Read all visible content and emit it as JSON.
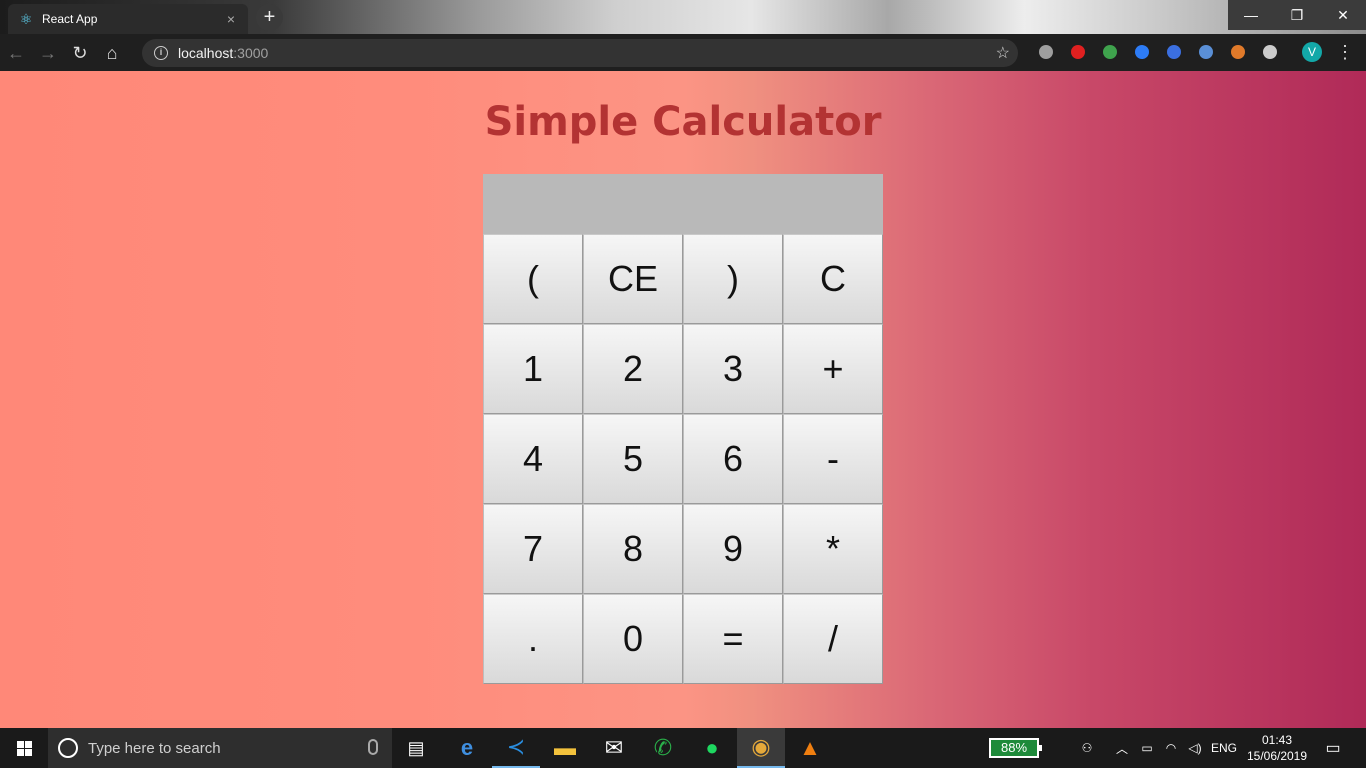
{
  "browser": {
    "tab": {
      "title": "React App",
      "favicon": "react-icon",
      "close": "×"
    },
    "new_tab": "+",
    "url": {
      "host": "localhost",
      "port": ":3000"
    },
    "window_controls": {
      "minimize": "—",
      "maximize": "❐",
      "close": "✕"
    },
    "nav": {
      "back": "←",
      "forward": "→",
      "reload": "↻",
      "home": "⌂"
    },
    "bookmark_star": "☆",
    "profile_initial": "V",
    "menu": "⋮",
    "extensions": [
      {
        "name": "extension-docs-icon",
        "color": "#9e9e9e"
      },
      {
        "name": "extension-adblock-icon",
        "color": "#e02020"
      },
      {
        "name": "extension-colorful-icon",
        "color": "#3fa34d"
      },
      {
        "name": "extension-messenger-icon",
        "color": "#2d7cf6"
      },
      {
        "name": "extension-messenger2-icon",
        "color": "#3b6fe0"
      },
      {
        "name": "extension-circle-icon",
        "color": "#5a8fd6"
      },
      {
        "name": "extension-owl-icon",
        "color": "#e07a2a"
      },
      {
        "name": "extension-bulb-icon",
        "color": "#cccccc"
      }
    ]
  },
  "app": {
    "title": "Simple Calculator",
    "display": "",
    "keys": [
      "(",
      "CE",
      ")",
      "C",
      "1",
      "2",
      "3",
      "+",
      "4",
      "5",
      "6",
      "-",
      "7",
      "8",
      "9",
      "*",
      ".",
      "0",
      "=",
      "/"
    ]
  },
  "taskbar": {
    "search_placeholder": "Type here to search",
    "battery": "88%",
    "language": "ENG",
    "time": "01:43",
    "date": "15/06/2019"
  },
  "colors": {
    "title": "#b33333",
    "display": "#b9b9b9",
    "gradient_start": "#ff8878",
    "gradient_end": "#b02a58"
  }
}
